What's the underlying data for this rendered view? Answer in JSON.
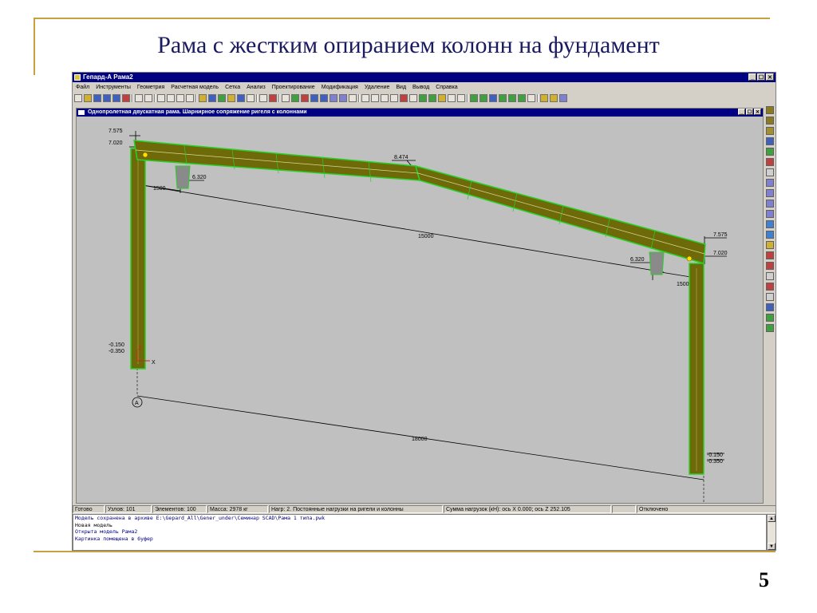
{
  "slide": {
    "title": "Рама с жестким опиранием колонн на фундамент",
    "number": "5"
  },
  "app": {
    "title": "Гепард-А Рама2",
    "window_buttons": [
      "_",
      "☐",
      "✕"
    ],
    "menu": [
      "Файл",
      "Инструменты",
      "Геометрия",
      "Расчетная модель",
      "Сетка",
      "Анализ",
      "Проектирование",
      "Модификация",
      "Удаление",
      "Вид",
      "Вывод",
      "Справка"
    ],
    "child_window": {
      "title": "Однопролетная двускатная рама. Шарнирное сопряжение ригеля с колоннами"
    }
  },
  "drawing": {
    "dims": {
      "left_top": "7.575",
      "left_eave": "7.020",
      "ridge": "8.474",
      "left_bracket": "6.320",
      "left_offset": "1500",
      "span": "15000",
      "right_top": "7.575",
      "right_eave": "7.020",
      "right_bracket": "6.320",
      "right_offset": "1500",
      "left_base1": "-0.150",
      "left_base2": "-0.350",
      "right_base1": "-0.150",
      "right_base2": "-0.350",
      "length": "18000",
      "axis_label": "A",
      "axis_z": "Z",
      "axis_x": "X"
    }
  },
  "status": {
    "ready": "Готово",
    "nodes": "Узлов: 101",
    "elements": "Элементов: 100",
    "mass": "Масса: 2978 кг",
    "load": "Нагр: 2. Постоянные нагрузки на ригели и колонны",
    "sum": "Сумма нагрузок (кН): ось X 0.000;  ось Z 252.105",
    "mode": "Отключено"
  },
  "console": [
    "Модель сохранена в архиве E:\\Gepard_All\\Gener_under\\Семинар SCAD\\Рама 1 типа.pwk",
    "Новая модель",
    "Открыта модель Рама2",
    "Картинка помещена в буфер"
  ],
  "colors": {
    "beam_fill": "#6e6a0a",
    "beam_edge": "#28d028",
    "slide_accent": "#c8a040",
    "title_text": "#1a1a60"
  }
}
